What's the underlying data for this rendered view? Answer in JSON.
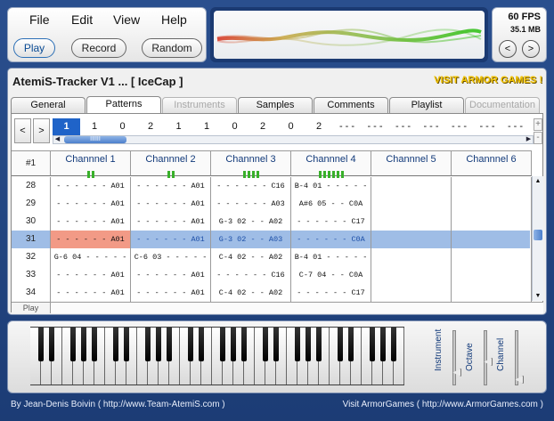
{
  "menu": {
    "file": "File",
    "edit": "Edit",
    "view": "View",
    "help": "Help"
  },
  "transport": {
    "play": "Play",
    "record": "Record",
    "random": "Random"
  },
  "stats": {
    "fps": "60 FPS",
    "memory": "35.1 MB",
    "prev": "<",
    "next": ">"
  },
  "app": {
    "title": "AtemiS-Tracker V1 ... [ IceCap ]",
    "armor_link": "VISIT ARMOR GAMES !"
  },
  "tabs": [
    {
      "label": "General",
      "state": "normal"
    },
    {
      "label": "Patterns",
      "state": "active"
    },
    {
      "label": "Instruments",
      "state": "disabled"
    },
    {
      "label": "Samples",
      "state": "normal"
    },
    {
      "label": "Comments",
      "state": "normal"
    },
    {
      "label": "Playlist",
      "state": "normal"
    },
    {
      "label": "Documentation",
      "state": "disabled"
    }
  ],
  "order": {
    "prev": "<",
    "next": ">",
    "plus": "+",
    "minus": "-",
    "cells": [
      "1",
      "1",
      "0",
      "2",
      "1",
      "1",
      "0",
      "2",
      "0",
      "2",
      "- - -",
      "- - -",
      "- - -",
      "- - -",
      "- - -",
      "- - -",
      "- - -"
    ],
    "scroll_grip": "IIIIII",
    "scroll_left": "◀",
    "scroll_right": "▶"
  },
  "grid": {
    "row_header": "#1",
    "channels": [
      {
        "name": "Channnel 1",
        "bars": 2
      },
      {
        "name": "Channnel 2",
        "bars": 2
      },
      {
        "name": "Channnel 3",
        "bars": 4
      },
      {
        "name": "Channnel 4",
        "bars": 6
      },
      {
        "name": "Channnel 5",
        "bars": 0
      },
      {
        "name": "Channnel 6",
        "bars": 0
      }
    ],
    "rows": [
      {
        "num": "28",
        "cells": [
          "- - - - - - A01",
          "- - - - - - A01",
          "- - - - - - C16",
          "B-4 01 - - - - -"
        ]
      },
      {
        "num": "29",
        "cells": [
          "- - - - - - A01",
          "- - - - - - A01",
          "- - - - - - A03",
          "A#6 05 - - C0A"
        ]
      },
      {
        "num": "30",
        "cells": [
          "- - - - - - A01",
          "- - - - - - A01",
          "G-3 02 - - A02",
          "- - - - - - C17"
        ]
      },
      {
        "num": "31",
        "cells": [
          "- - - - - - A01",
          "- - - - - - A01",
          "G-3 02 - - A03",
          "- - - - - - C0A"
        ]
      },
      {
        "num": "32",
        "cells": [
          "G-6 04 - - - - -",
          "C-6 03 - - - - -",
          "C-4 02 - - A02",
          "B-4 01 - - - - -"
        ]
      },
      {
        "num": "33",
        "cells": [
          "- - - - - - A01",
          "- - - - - - A01",
          "- - - - - - C16",
          "C-7 04 - - C0A"
        ]
      },
      {
        "num": "34",
        "cells": [
          "- - - - - - A01",
          "- - - - - - A01",
          "C-4 02 - - A02",
          "- - - - - - C17"
        ]
      }
    ],
    "highlight_row": 3,
    "play_label": "Play"
  },
  "sliders": {
    "instrument": "Instrument",
    "octave": "Octave",
    "channel": "Channel"
  },
  "footer": {
    "left": "By Jean-Denis Boivin ( http://www.Team-AtemiS.com )",
    "right": "Visit ArmorGames ( http://www.ArmorGames.com )"
  },
  "colors": {
    "accent": "#1f63c8",
    "highlight_row": "#9fbde6",
    "cursor_cell": "#f29a86",
    "brand_link": "#f3c400"
  }
}
